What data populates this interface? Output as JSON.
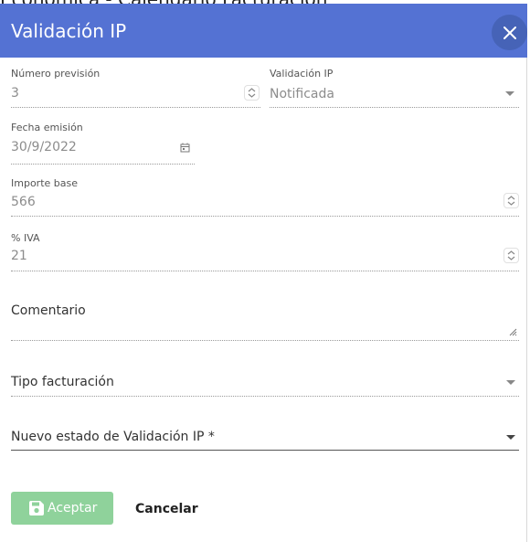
{
  "background": {
    "title_fragment": "Económica - Calendario Facturación"
  },
  "dialog": {
    "title": "Validación IP",
    "header_color": "#5472d3",
    "close_icon": "close-icon"
  },
  "fields": {
    "numero_prevision": {
      "label": "Número previsión",
      "value": "3"
    },
    "validacion_ip": {
      "label": "Validación IP",
      "value": "Notificada"
    },
    "fecha_emision": {
      "label": "Fecha emisión",
      "value": "30/9/2022"
    },
    "importe_base": {
      "label": "Importe base",
      "value": "566"
    },
    "iva": {
      "label": "% IVA",
      "value": "21"
    },
    "comentario": {
      "label": "Comentario"
    },
    "tipo_facturacion": {
      "label": "Tipo facturación"
    },
    "nuevo_estado": {
      "label": "Nuevo estado de Validación IP *"
    }
  },
  "actions": {
    "accept_label": "Aceptar",
    "accept_color": "#8fd29b",
    "cancel_label": "Cancelar"
  }
}
